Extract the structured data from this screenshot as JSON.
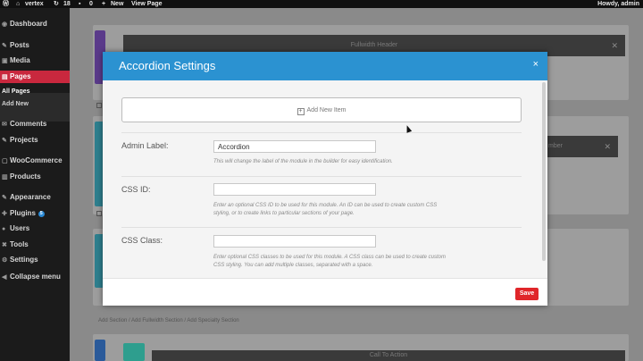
{
  "admin_bar": {
    "site_name": "vertex",
    "updates_count": "18",
    "comments_count": "0",
    "new_label": "New",
    "view_page_label": "View Page",
    "howdy": "Howdy, admin"
  },
  "sidebar": {
    "items": [
      {
        "label": "Dashboard",
        "icon": "dashboard-icon",
        "glyph": "◉"
      },
      {
        "label": "Posts",
        "icon": "pin-icon",
        "glyph": "✎"
      },
      {
        "label": "Media",
        "icon": "media-icon",
        "glyph": "▣"
      },
      {
        "label": "Pages",
        "icon": "pages-icon",
        "glyph": "▤"
      },
      {
        "label": "Comments",
        "icon": "comments-icon",
        "glyph": "✉"
      },
      {
        "label": "Projects",
        "icon": "projects-icon",
        "glyph": "✎"
      },
      {
        "label": "WooCommerce",
        "icon": "woocommerce-icon",
        "glyph": "▢"
      },
      {
        "label": "Products",
        "icon": "products-icon",
        "glyph": "▥"
      },
      {
        "label": "Appearance",
        "icon": "appearance-icon",
        "glyph": "✎"
      },
      {
        "label": "Plugins",
        "icon": "plugins-icon",
        "glyph": "✚",
        "badge": "5"
      },
      {
        "label": "Users",
        "icon": "users-icon",
        "glyph": "●"
      },
      {
        "label": "Tools",
        "icon": "tools-icon",
        "glyph": "✖"
      },
      {
        "label": "Settings",
        "icon": "settings-icon",
        "glyph": "⚙"
      },
      {
        "label": "Collapse menu",
        "icon": "collapse-icon",
        "glyph": "◀"
      }
    ],
    "submenu": [
      "All Pages",
      "Add New"
    ]
  },
  "builder": {
    "fullwidth_header_label": "Fullwidth Header",
    "member_label": "mber",
    "add_section_links": "Add Section / Add Fullwidth Section / Add Specialty Section",
    "call_to_action_label": "Call To Action"
  },
  "modal": {
    "title": "Accordion Settings",
    "close_glyph": "×",
    "add_new_item_label": "Add New Item",
    "admin_label": {
      "label": "Admin Label:",
      "value": "Accordion",
      "help": "This will change the label of the module in the builder for easy identification."
    },
    "css_id": {
      "label": "CSS ID:",
      "value": "",
      "help": "Enter an optional CSS ID to be used for this module. An ID can be used to create custom CSS styling, or to create links to particular sections of your page."
    },
    "css_class": {
      "label": "CSS Class:",
      "value": "",
      "help": "Enter optional CSS classes to be used for this module. A CSS class can be used to create custom CSS styling. You can add multiple classes, separated with a space."
    },
    "save_label": "Save"
  },
  "colors": {
    "modal_header": "#2b92d1",
    "save_button": "#e0262a",
    "active_menu": "#c9283e"
  }
}
